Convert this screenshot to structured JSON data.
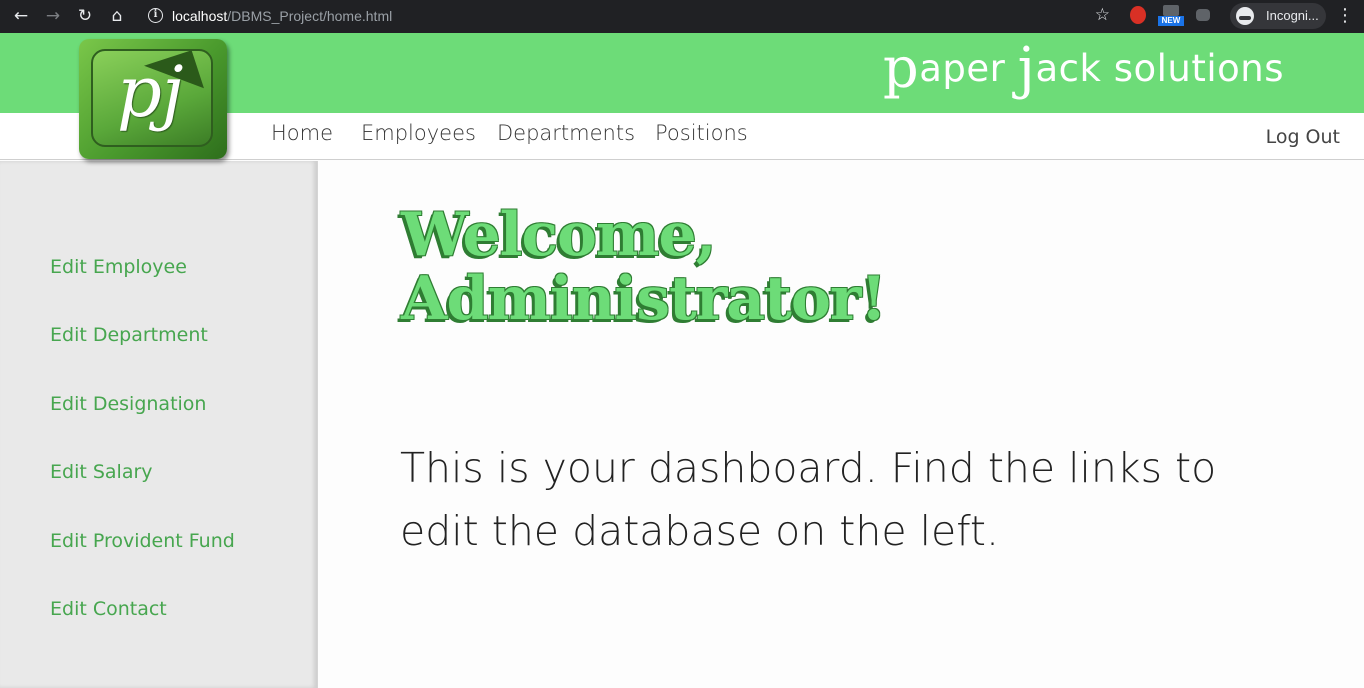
{
  "browser": {
    "url_host": "localhost",
    "url_path": "/DBMS_Project/home.html",
    "incognito_label": "Incogni...",
    "extension_badge": "NEW",
    "icons": [
      "back-icon",
      "forward-icon",
      "reload-icon",
      "home-icon",
      "info-icon",
      "star-icon",
      "menu-icon"
    ]
  },
  "brand": {
    "p_letter": "p",
    "aper": "aper ",
    "j_letter": "j",
    "ack": "ack  solutions",
    "logo_text": "pj"
  },
  "nav": {
    "items": [
      "Home",
      "Employees",
      "Departments",
      "Positions"
    ],
    "logout": "Log Out"
  },
  "sidebar": {
    "items": [
      "Edit Employee",
      "Edit Department",
      "Edit Designation",
      "Edit Salary",
      "Edit Provident Fund",
      "Edit Contact"
    ]
  },
  "main": {
    "welcome_line1": "Welcome,",
    "welcome_line2": "Administrator!",
    "message": "This is your dashboard. Find the links to edit the database on the left."
  },
  "colors": {
    "header_green": "#6ddc78",
    "sidebar_link_green": "#47a64f",
    "sidebar_bg": "#e9e9e9"
  }
}
